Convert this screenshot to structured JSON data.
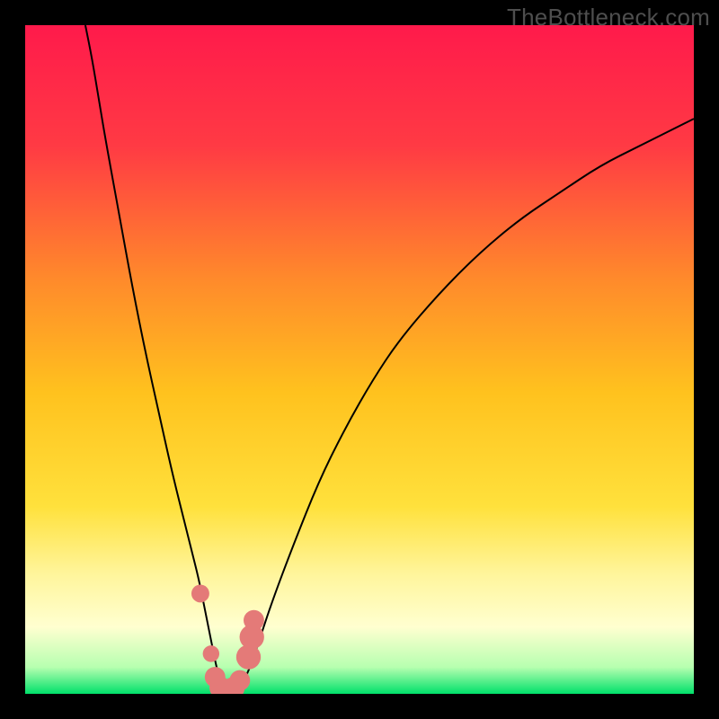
{
  "watermark": "TheBottleneck.com",
  "chart_data": {
    "type": "line",
    "title": "",
    "xlabel": "",
    "ylabel": "",
    "xlim": [
      0,
      100
    ],
    "ylim": [
      0,
      100
    ],
    "background_gradient": {
      "stops": [
        {
          "offset": 0.0,
          "color": "#ff1a4b"
        },
        {
          "offset": 0.18,
          "color": "#ff3a44"
        },
        {
          "offset": 0.38,
          "color": "#ff8a2b"
        },
        {
          "offset": 0.55,
          "color": "#ffc21e"
        },
        {
          "offset": 0.72,
          "color": "#ffe13c"
        },
        {
          "offset": 0.82,
          "color": "#fff59b"
        },
        {
          "offset": 0.9,
          "color": "#ffffd0"
        },
        {
          "offset": 0.96,
          "color": "#b7ffb0"
        },
        {
          "offset": 1.0,
          "color": "#00e06a"
        }
      ]
    },
    "series": [
      {
        "name": "bottleneck-curve",
        "color": "#000000",
        "x": [
          9,
          10,
          11,
          12,
          14,
          16,
          18,
          20,
          22,
          24,
          25,
          26,
          27,
          28,
          28.5,
          29,
          29.5,
          30,
          31,
          32,
          33,
          34,
          35,
          37,
          40,
          44,
          48,
          52,
          56,
          62,
          68,
          74,
          80,
          86,
          92,
          98,
          100
        ],
        "y": [
          100,
          95,
          89,
          83,
          72,
          61,
          51,
          42,
          33,
          25,
          21,
          17,
          12,
          7,
          4.5,
          2.5,
          1.2,
          0.5,
          0.5,
          1.0,
          2.5,
          5,
          8,
          14,
          22,
          32,
          40,
          47,
          53,
          60,
          66,
          71,
          75,
          79,
          82,
          85,
          86
        ]
      }
    ],
    "markers": {
      "name": "tick-dots",
      "color": "#e47a78",
      "points": [
        {
          "x": 26.2,
          "y": 15.0,
          "r": 1.6
        },
        {
          "x": 27.8,
          "y": 6.0,
          "r": 1.4
        },
        {
          "x": 28.4,
          "y": 2.5,
          "r": 2.0
        },
        {
          "x": 29.2,
          "y": 0.9,
          "r": 2.2
        },
        {
          "x": 30.2,
          "y": 0.6,
          "r": 2.2
        },
        {
          "x": 31.2,
          "y": 0.9,
          "r": 2.2
        },
        {
          "x": 32.1,
          "y": 2.0,
          "r": 2.0
        },
        {
          "x": 33.4,
          "y": 5.5,
          "r": 2.6
        },
        {
          "x": 33.9,
          "y": 8.5,
          "r": 2.6
        },
        {
          "x": 34.2,
          "y": 11.0,
          "r": 2.0
        }
      ]
    }
  }
}
